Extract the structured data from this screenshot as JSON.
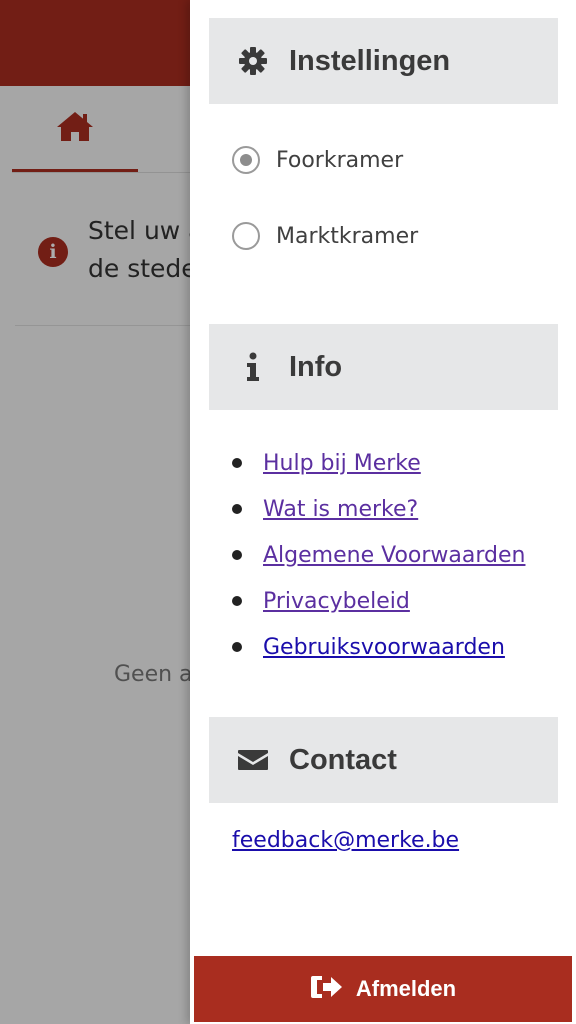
{
  "background": {
    "alert_text": "Stel uw a\nde stede",
    "empty_text": "Geen a"
  },
  "drawer": {
    "settings": {
      "title": "Instellingen",
      "options": [
        {
          "label": "Foorkramer",
          "selected": true
        },
        {
          "label": "Marktkramer",
          "selected": false
        }
      ]
    },
    "info": {
      "title": "Info",
      "links": [
        {
          "label": "Hulp bij Merke",
          "visited": true
        },
        {
          "label": "Wat is merke?",
          "visited": true
        },
        {
          "label": "Algemene Voorwaarden",
          "visited": true
        },
        {
          "label": "Privacybeleid",
          "visited": true
        },
        {
          "label": "Gebruiksvoorwaarden",
          "visited": false
        }
      ]
    },
    "contact": {
      "title": "Contact",
      "email": "feedback@merke.be"
    },
    "logout_label": "Afmelden"
  },
  "colors": {
    "brand": "#a92d1f",
    "section_bg": "#e6e7e8",
    "link_visited": "#5b2fa0",
    "link": "#1a0dab"
  },
  "icons": {
    "home": "home-icon",
    "alert": "exclamation-circle-icon",
    "settings": "gear-icon",
    "info": "info-icon",
    "contact": "envelope-icon",
    "logout": "sign-out-icon"
  }
}
